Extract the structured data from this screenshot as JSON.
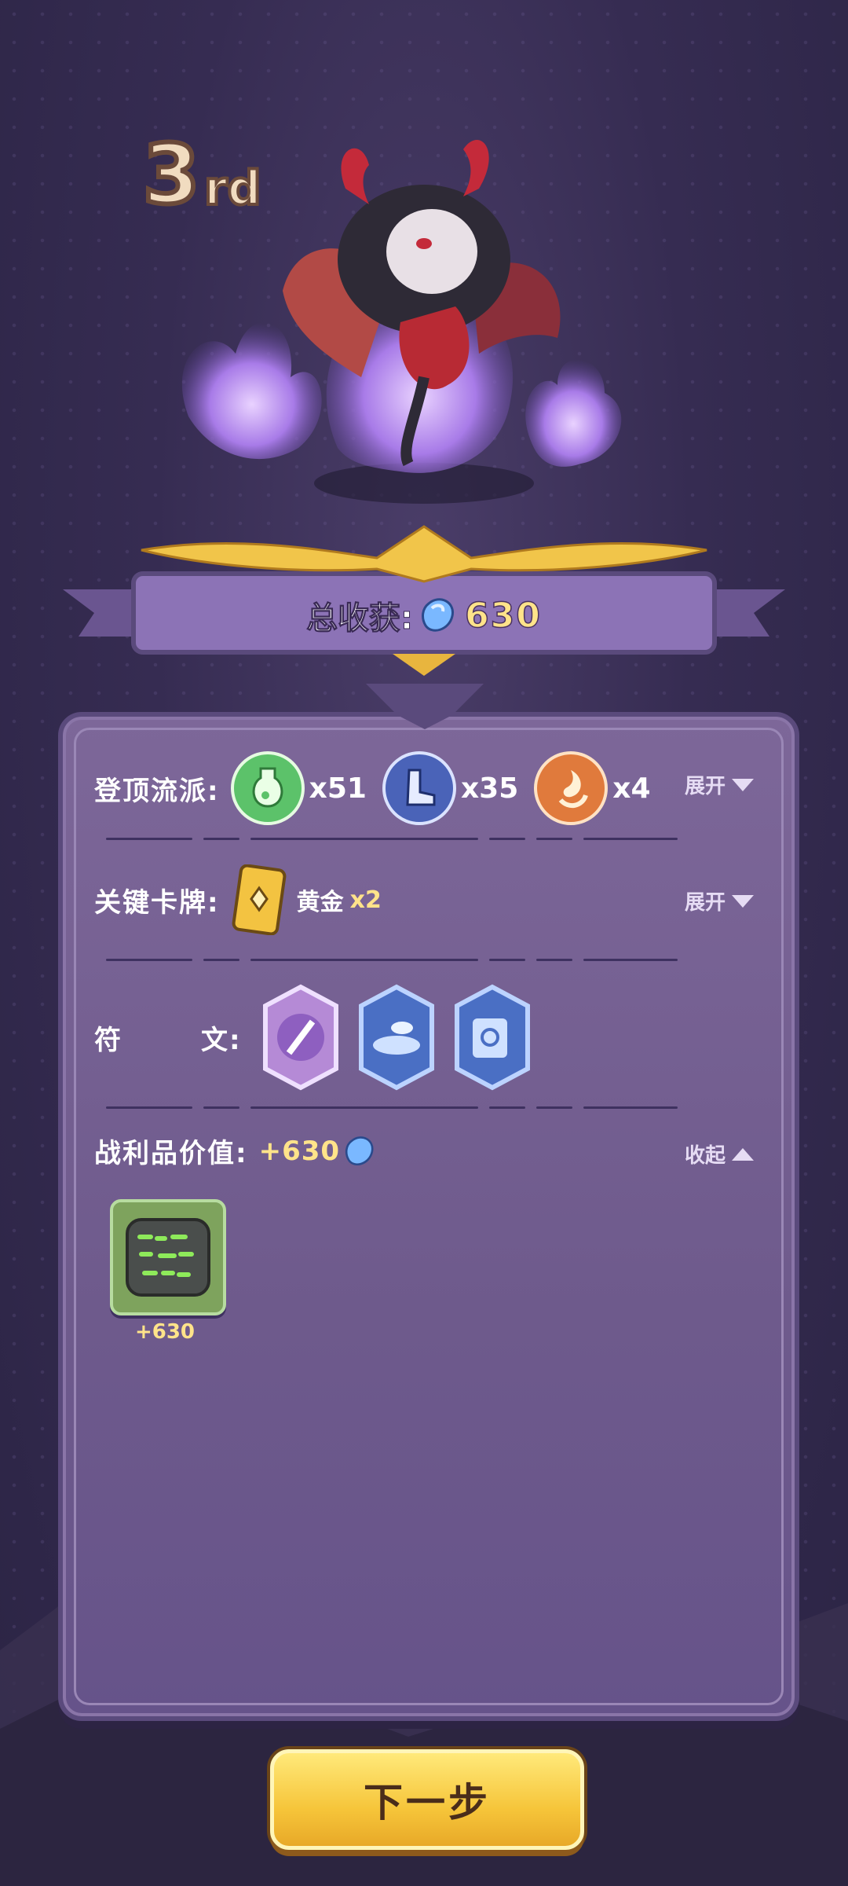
{
  "rank": {
    "number": "3",
    "suffix": "rd"
  },
  "total": {
    "label": "总收获:",
    "value": "630"
  },
  "style_row": {
    "label": "登顶流派:",
    "items": [
      {
        "icon": "potion-icon",
        "count": "x51"
      },
      {
        "icon": "boot-icon",
        "count": "x35"
      },
      {
        "icon": "fire-swirl-icon",
        "count": "x4"
      }
    ],
    "toggle": "展开"
  },
  "key_card_row": {
    "label": "关键卡牌:",
    "card_name": "黄金",
    "card_count": "x2",
    "toggle": "展开"
  },
  "rune_row": {
    "label_a": "符",
    "label_b": "文:",
    "runes": [
      "blade-rune-icon",
      "coin-pile-rune-icon",
      "shield-rune-icon"
    ]
  },
  "loot_row": {
    "label": "战利品价值:",
    "value": "+630",
    "toggle": "收起"
  },
  "loot_items": [
    {
      "icon": "rune-stone-icon",
      "value": "+630"
    }
  ],
  "next_button": "下一步",
  "colors": {
    "accent_gold": "#ffe38a",
    "panel": "#7d6799",
    "background": "#362c52"
  }
}
